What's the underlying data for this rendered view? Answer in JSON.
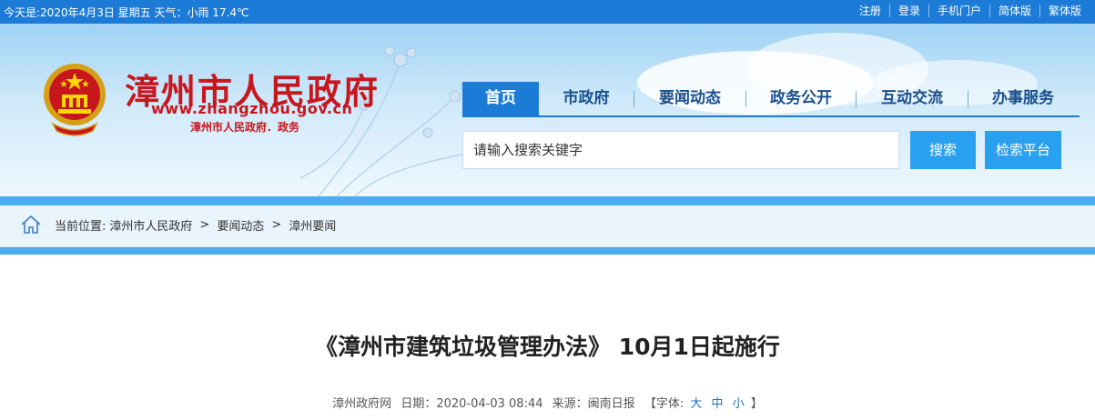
{
  "topbar": {
    "info": "今天是:2020年4月3日 星期五 天气：小雨 17.4℃",
    "links": [
      "注册",
      "登录",
      "手机门户",
      "简体版",
      "繁体版"
    ]
  },
  "header": {
    "title": "漳州市人民政府",
    "url": "www.zhangzhou.gov.cn",
    "subtitle": "漳州市人民政府．政务"
  },
  "nav": {
    "items": [
      "首页",
      "市政府",
      "要闻动态",
      "政务公开",
      "互动交流",
      "办事服务"
    ],
    "active": "首页"
  },
  "search": {
    "placeholder": "请输入搜索关键字",
    "search_label": "搜索",
    "platform_label": "检索平台"
  },
  "breadcrumb": {
    "label": "当前位置:",
    "items": [
      "漳州市人民政府",
      "要闻动态",
      "漳州要闻"
    ],
    "separator": ">"
  },
  "article": {
    "title": "《漳州市建筑垃圾管理办法》 10月1日起施行",
    "source_label": "漳州政府网",
    "date_label": "日期：",
    "date": "2020-04-03 08:44",
    "origin_label": "来源：",
    "origin": "闽南日报",
    "font_label_open": "【字体:",
    "font_sizes": [
      "大",
      "中",
      "小"
    ],
    "font_label_close": "】"
  },
  "colors": {
    "primary": "#1c7bd6",
    "accent": "#29a0f0",
    "title_red": "#c8161d",
    "nav_text": "#1a4f8c"
  }
}
